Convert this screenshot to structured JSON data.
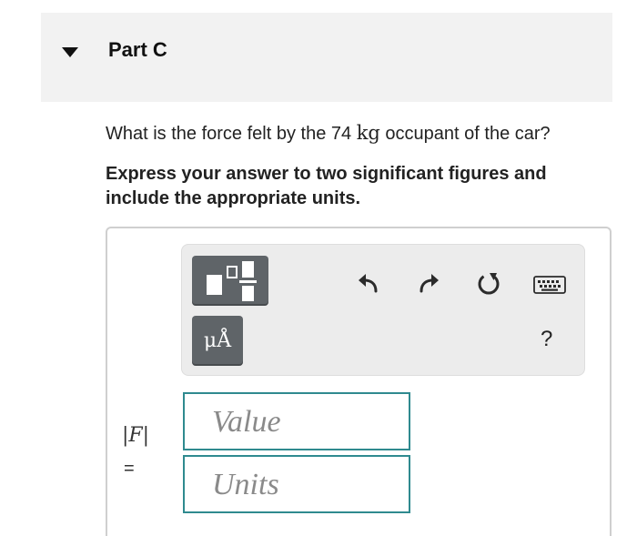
{
  "part": {
    "title": "Part C",
    "collapse_icon": "caret-down-icon"
  },
  "question": {
    "prefix": "What is the force felt by the 74 ",
    "unit": "kg",
    "suffix": " occupant of the car?"
  },
  "instruction": "Express your answer to two significant figures and include the appropriate units.",
  "toolbar": {
    "templates_icon": "templates-icon",
    "units_label": "μÅ",
    "undo_icon": "undo-icon",
    "redo_icon": "redo-icon",
    "reset_icon": "reset-icon",
    "keyboard_icon": "keyboard-icon",
    "help_label": "?"
  },
  "answer": {
    "variable_label": "|F|",
    "equals": "=",
    "value_placeholder": "Value",
    "units_placeholder": "Units"
  },
  "colors": {
    "header_bg": "#f2f2f2",
    "toolbar_bg": "#ececec",
    "tool_button": "#5f6468",
    "input_border": "#2f8a8f"
  }
}
